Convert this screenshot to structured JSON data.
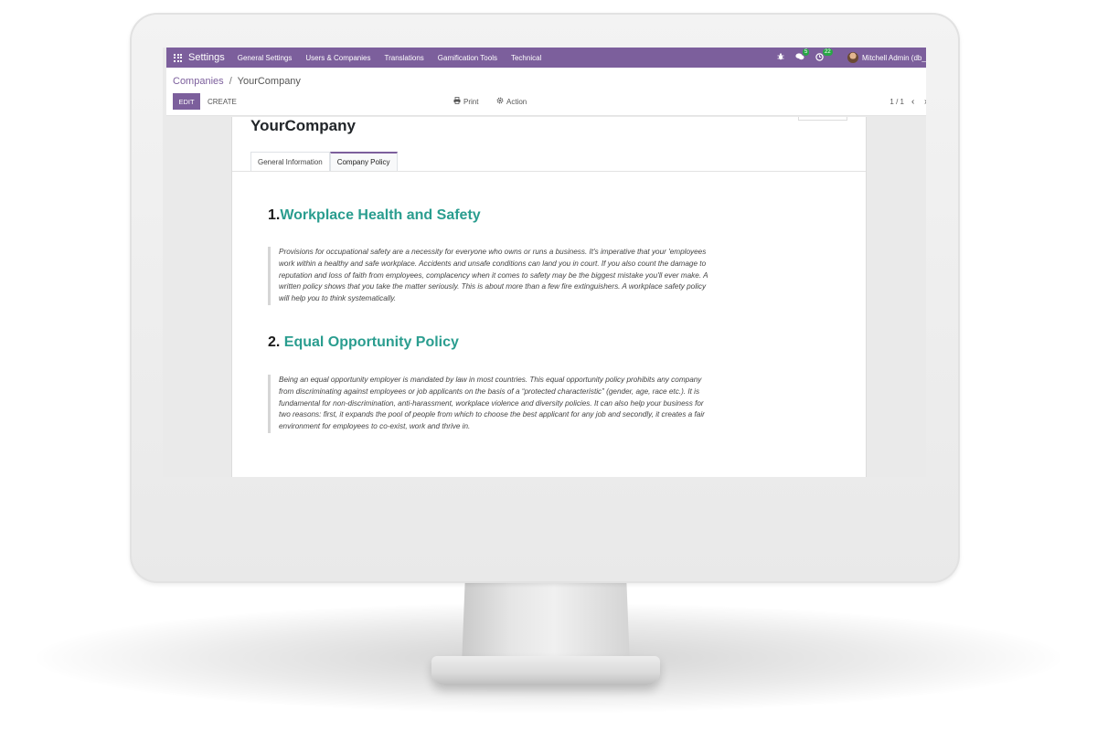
{
  "navbar": {
    "app_title": "Settings",
    "menu": [
      "General Settings",
      "Users & Companies",
      "Translations",
      "Gamification Tools",
      "Technical"
    ],
    "bug_icon": "bug-icon",
    "messages_count": "5",
    "activities_count": "22",
    "user_name": "Mitchell Admin (db_"
  },
  "breadcrumb": {
    "parent": "Companies",
    "separator": "/",
    "current": "YourCompany"
  },
  "toolbar": {
    "edit_label": "EDIT",
    "create_label": "CREATE",
    "print_label": "Print",
    "action_label": "Action",
    "pager": "1 / 1",
    "prev_icon": "chevron-left-icon",
    "next_icon": "chevron-right-icon"
  },
  "form": {
    "company_name": "YourCompany",
    "tabs": [
      "General Information",
      "Company Policy"
    ],
    "active_tab": "Company Policy",
    "sections": [
      {
        "number": "1.",
        "title": "Workplace Health and Safety",
        "text": "Provisions for occupational safety are a necessity for everyone who owns or runs a business. It's imperative that your 'employees work within a healthy and safe workplace. Accidents and unsafe conditions can land you in court. If you also count the damage to reputation and loss of faith from employees, complacency when it comes to safety may be the biggest mistake you'll ever make. A written policy shows that you take the matter seriously. This is about more than a few fire extinguishers. A workplace safety policy will help you to think systematically."
      },
      {
        "number": "2.",
        "title": "Equal Opportunity Policy",
        "text": "Being an equal opportunity employer is mandated by law in most countries. This equal opportunity policy prohibits any company from discriminating against employees or job applicants on the basis of a “protected characteristic” (gender, age, race etc.). It is fundamental for non-discrimination, anti-harassment, workplace violence and diversity policies. It can also help your business for two reasons: first, it expands the pool of people from which to choose the best applicant for any job and secondly, it creates a fair environment for employees to co-exist, work and thrive in."
      }
    ]
  },
  "colors": {
    "brand": "#7c5f9c",
    "heading_accent": "#2a9d8f",
    "badge": "#28a745"
  }
}
